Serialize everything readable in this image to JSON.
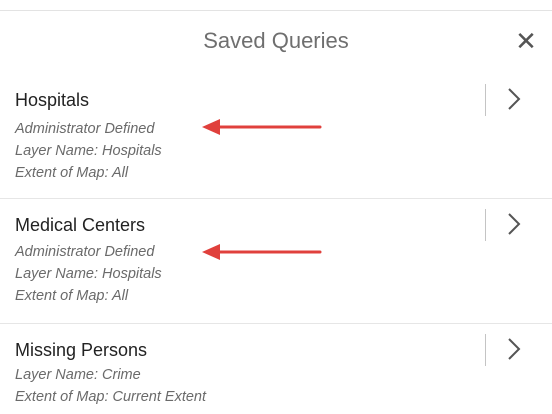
{
  "panel": {
    "title": "Saved Queries",
    "close_icon": "close-icon"
  },
  "queries": [
    {
      "title": "Hospitals",
      "lines": [
        "Administrator Defined",
        "Layer Name: Hospitals",
        "Extent of Map: All"
      ],
      "annotated": true
    },
    {
      "title": "Medical Centers",
      "lines": [
        "Administrator Defined",
        "Layer Name: Hospitals",
        "Extent of Map: All"
      ],
      "annotated": true
    },
    {
      "title": "Missing Persons",
      "lines": [
        "Layer Name: Crime",
        "Extent of Map: Current Extent"
      ],
      "annotated": false
    }
  ],
  "colors": {
    "annotation_arrow": "#e0403c",
    "title_text": "#6f6f6f",
    "item_title": "#222222",
    "item_detail": "#6a6a6a"
  }
}
